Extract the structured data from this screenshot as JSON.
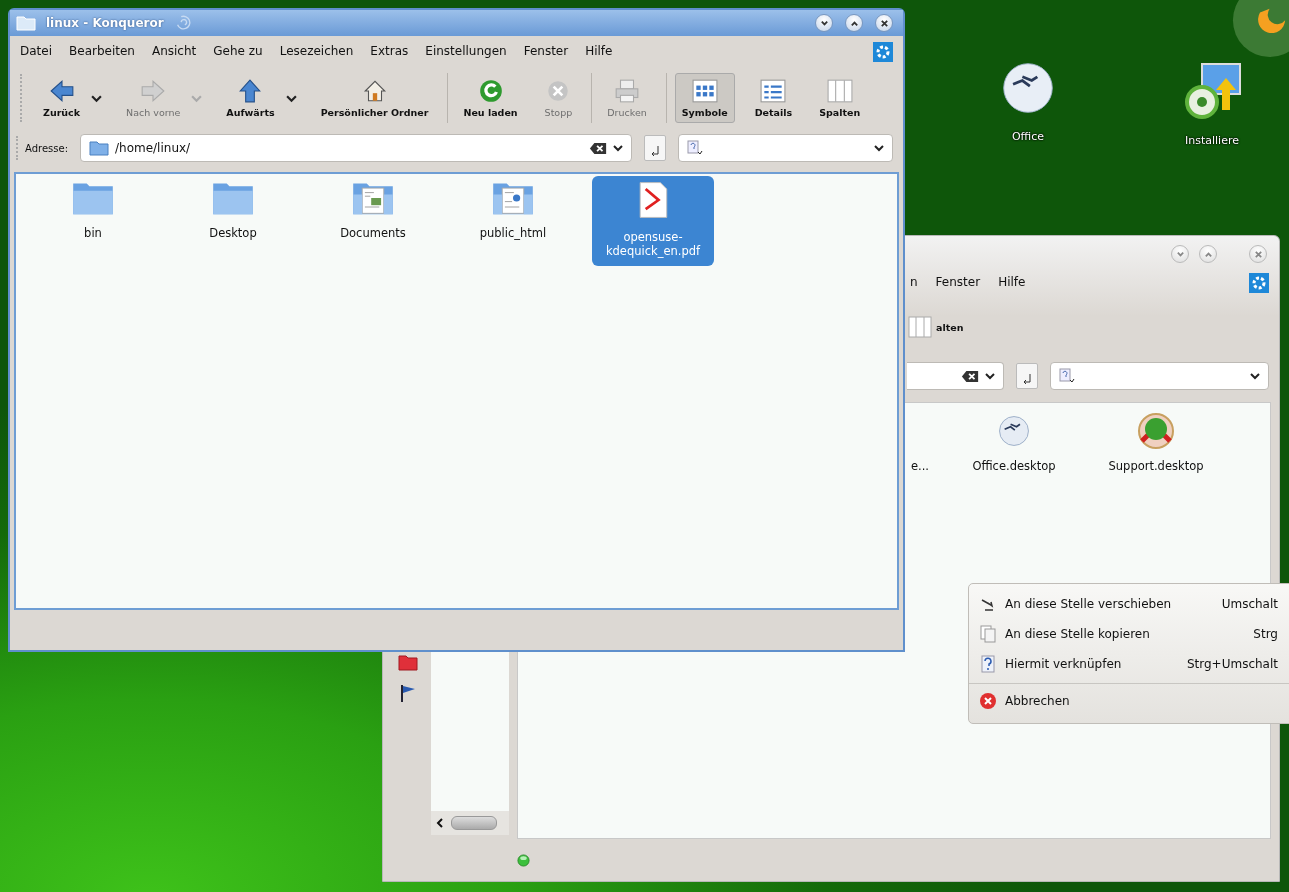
{
  "desktop": {
    "icons": [
      {
        "label": "Office",
        "kind": "office"
      },
      {
        "label": "Installiere",
        "kind": "installer"
      }
    ]
  },
  "back_window": {
    "menu": [
      "n",
      "Fenster",
      "Hilfe"
    ],
    "toolbar_label": "alten",
    "files": [
      {
        "label": "e..."
      },
      {
        "label": "Office.desktop",
        "kind": "office"
      },
      {
        "label": "Support.desktop",
        "kind": "support"
      }
    ]
  },
  "front_window": {
    "title": "linux - Konqueror",
    "menu": [
      "Datei",
      "Bearbeiten",
      "Ansicht",
      "Gehe zu",
      "Lesezeichen",
      "Extras",
      "Einstellungen",
      "Fenster",
      "Hilfe"
    ],
    "toolbar": [
      {
        "label": "Zurück",
        "disabled": false,
        "selected": false,
        "dropdown": true,
        "separator_before": false
      },
      {
        "label": "Nach vorne",
        "disabled": true,
        "selected": false,
        "dropdown": true,
        "separator_before": false
      },
      {
        "label": "Aufwärts",
        "disabled": false,
        "selected": false,
        "dropdown": true,
        "separator_before": false
      },
      {
        "label": "Persönlicher Ordner",
        "disabled": false,
        "selected": false,
        "dropdown": false,
        "separator_before": false
      },
      {
        "label": "Neu laden",
        "disabled": false,
        "selected": false,
        "dropdown": false,
        "separator_before": true
      },
      {
        "label": "Stopp",
        "disabled": true,
        "selected": false,
        "dropdown": false,
        "separator_before": false
      },
      {
        "label": "Drucken",
        "disabled": true,
        "selected": false,
        "dropdown": false,
        "separator_before": true
      },
      {
        "label": "Symbole",
        "disabled": false,
        "selected": true,
        "dropdown": false,
        "separator_before": true
      },
      {
        "label": "Details",
        "disabled": false,
        "selected": false,
        "dropdown": false,
        "separator_before": false
      },
      {
        "label": "Spalten",
        "disabled": false,
        "selected": false,
        "dropdown": false,
        "separator_before": false
      }
    ],
    "address": {
      "label": "Adresse:",
      "value": "/home/linux/"
    },
    "files": [
      {
        "label": "bin",
        "kind": "folder",
        "selected": false
      },
      {
        "label": "Desktop",
        "kind": "folder",
        "selected": false
      },
      {
        "label": "Documents",
        "kind": "documents",
        "selected": false
      },
      {
        "label": "public_html",
        "kind": "web",
        "selected": false
      },
      {
        "label": "opensuse-kdequick_en.pdf",
        "kind": "pdf",
        "selected": true
      }
    ]
  },
  "context_menu": [
    {
      "label": "An diese Stelle verschieben",
      "shortcut": "Umschalt",
      "separator_before": false
    },
    {
      "label": "An diese Stelle kopieren",
      "shortcut": "Strg",
      "separator_before": false
    },
    {
      "label": "Hiermit verknüpfen",
      "shortcut": "Strg+Umschalt",
      "separator_before": false
    },
    {
      "label": "Abbrechen",
      "separator_before": true
    }
  ]
}
